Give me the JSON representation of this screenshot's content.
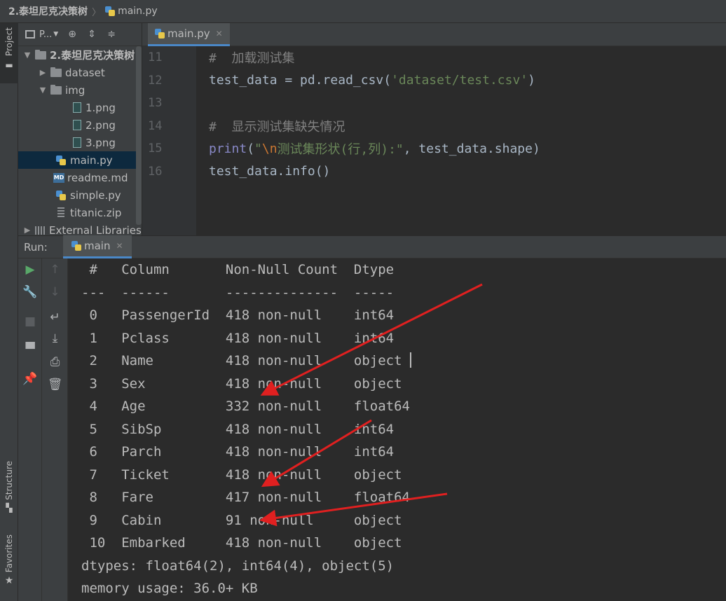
{
  "breadcrumb": {
    "project": "2.泰坦尼克决策树",
    "file": "main.py"
  },
  "left_strip": {
    "project": "Project",
    "structure": "Structure",
    "favorites": "Favorites"
  },
  "project_panel": {
    "title": "P...",
    "tree": {
      "root": "2.泰坦尼克决策树",
      "dataset": "dataset",
      "img": "img",
      "img1": "1.png",
      "img2": "2.png",
      "img3": "3.png",
      "main": "main.py",
      "readme": "readme.md",
      "simple": "simple.py",
      "zip": "titanic.zip",
      "external": "External Libraries"
    }
  },
  "editor": {
    "tab": "main.py",
    "line_numbers": [
      "11",
      "12",
      "13",
      "14",
      "15",
      "16"
    ],
    "code": {
      "l11": "#  加载测试集",
      "l12_a": "test_data = pd.read_csv(",
      "l12_b": "'dataset/test.csv'",
      "l12_c": ")",
      "l14": "#  显示测试集缺失情况",
      "l15_a": "print",
      "l15_b": "(",
      "l15_c": "\"",
      "l15_d": "\\n",
      "l15_e": "测试集形状(行,列):\"",
      "l15_f": ", test_data.shape)",
      "l16": "test_data.info()"
    }
  },
  "run": {
    "label": "Run:",
    "tab": "main"
  },
  "console": {
    "header": " #   Column       Non-Null Count  Dtype  ",
    "divider": "---  ------       --------------  -----  ",
    "rows": [
      " 0   PassengerId  418 non-null    int64  ",
      " 1   Pclass       418 non-null    int64  ",
      " 2   Name         418 non-null    object ",
      " 3   Sex          418 non-null    object ",
      " 4   Age          332 non-null    float64",
      " 5   SibSp        418 non-null    int64  ",
      " 6   Parch        418 non-null    int64  ",
      " 7   Ticket       418 non-null    object ",
      " 8   Fare         417 non-null    float64",
      " 9   Cabin        91 non-null     object ",
      " 10  Embarked     418 non-null    object "
    ],
    "dtypes": "dtypes: float64(2), int64(4), object(5)",
    "memory": "memory usage: 36.0+ KB"
  },
  "colors": {
    "annotation_arrow": "#e02020",
    "selection": "#0d293e",
    "tab_underline": "#4a88c7"
  }
}
